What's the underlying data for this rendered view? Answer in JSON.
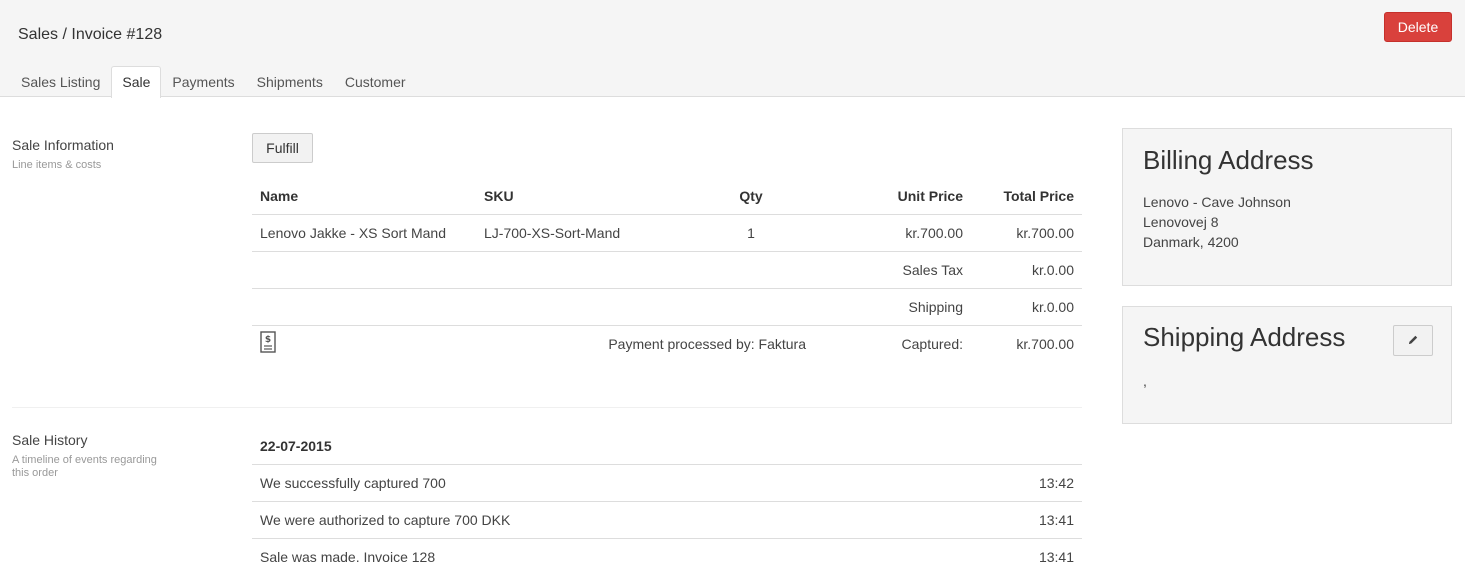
{
  "header": {
    "breadcrumb_section": "Sales",
    "breadcrumb_separator": " / ",
    "breadcrumb_page": "Invoice #128",
    "delete_label": "Delete"
  },
  "tabs": [
    {
      "label": "Sales Listing"
    },
    {
      "label": "Sale"
    },
    {
      "label": "Payments"
    },
    {
      "label": "Shipments"
    },
    {
      "label": "Customer"
    }
  ],
  "sale_info": {
    "title": "Sale Information",
    "subtitle": "Line items & costs",
    "fulfill_label": "Fulfill",
    "columns": {
      "name": "Name",
      "sku": "SKU",
      "qty": "Qty",
      "unit_price": "Unit Price",
      "total_price": "Total Price"
    },
    "items": [
      {
        "name": "Lenovo Jakke - XS Sort Mand",
        "sku": "LJ-700-XS-Sort-Mand",
        "qty": "1",
        "unit_price": "kr.700.00",
        "total_price": "kr.700.00"
      }
    ],
    "sales_tax_label": "Sales Tax",
    "sales_tax_value": "kr.0.00",
    "shipping_label": "Shipping",
    "shipping_value": "kr.0.00",
    "payment_processed": "Payment processed by: Faktura",
    "captured_label": "Captured:",
    "captured_value": "kr.700.00",
    "payment_icon": "invoice-dollar-icon"
  },
  "history": {
    "title": "Sale History",
    "subtitle": "A timeline of events regarding this order",
    "date": "22-07-2015",
    "events": [
      {
        "text": "We successfully captured 700",
        "time": "13:42"
      },
      {
        "text": "We were authorized to capture 700 DKK",
        "time": "13:41"
      },
      {
        "text": "Sale was made. Invoice 128",
        "time": "13:41"
      }
    ]
  },
  "billing": {
    "title": "Billing Address",
    "line1": "Lenovo - Cave Johnson",
    "line2": "Lenovovej 8",
    "line3": "Danmark, 4200"
  },
  "shipping": {
    "title": "Shipping Address",
    "line1": ",",
    "edit_icon": "pencil-icon"
  }
}
